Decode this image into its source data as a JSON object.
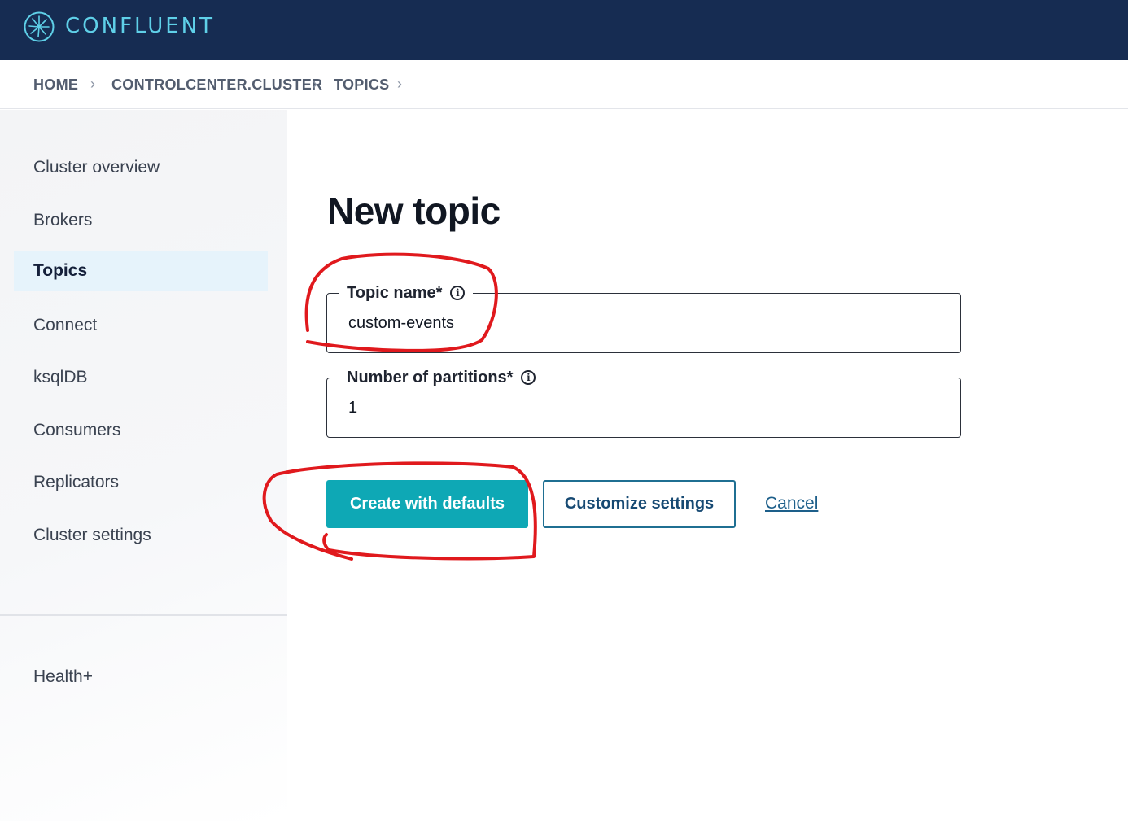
{
  "brand": {
    "logo_text": "CONFLUENT",
    "logo_icon": "confluent-starburst-icon",
    "header_color": "#162c52",
    "logo_color": "#5fd0e8"
  },
  "breadcrumb": {
    "items": [
      "HOME",
      "CONTROLCENTER.CLUSTER",
      "TOPICS"
    ],
    "separator_icon": "chevron-right-icon"
  },
  "sidebar": {
    "items": [
      {
        "label": "Cluster overview",
        "active": false
      },
      {
        "label": "Brokers",
        "active": false
      },
      {
        "label": "Topics",
        "active": true
      },
      {
        "label": "Connect",
        "active": false
      },
      {
        "label": "ksqlDB",
        "active": false
      },
      {
        "label": "Consumers",
        "active": false
      },
      {
        "label": "Replicators",
        "active": false
      },
      {
        "label": "Cluster settings",
        "active": false
      }
    ],
    "footer_item": "Health+"
  },
  "main": {
    "title": "New topic",
    "topic_name": {
      "label": "Topic name*",
      "value": "custom-events",
      "icon": "info-icon"
    },
    "partitions": {
      "label": "Number of partitions*",
      "value": "1",
      "icon": "info-icon"
    },
    "actions": {
      "primary": "Create with defaults",
      "secondary": "Customize settings",
      "cancel": "Cancel"
    },
    "accent_color": "#0ea8b5"
  },
  "annotations": {
    "color": "#e0191d",
    "marks": [
      "topic-name-circle",
      "create-button-circle"
    ]
  }
}
